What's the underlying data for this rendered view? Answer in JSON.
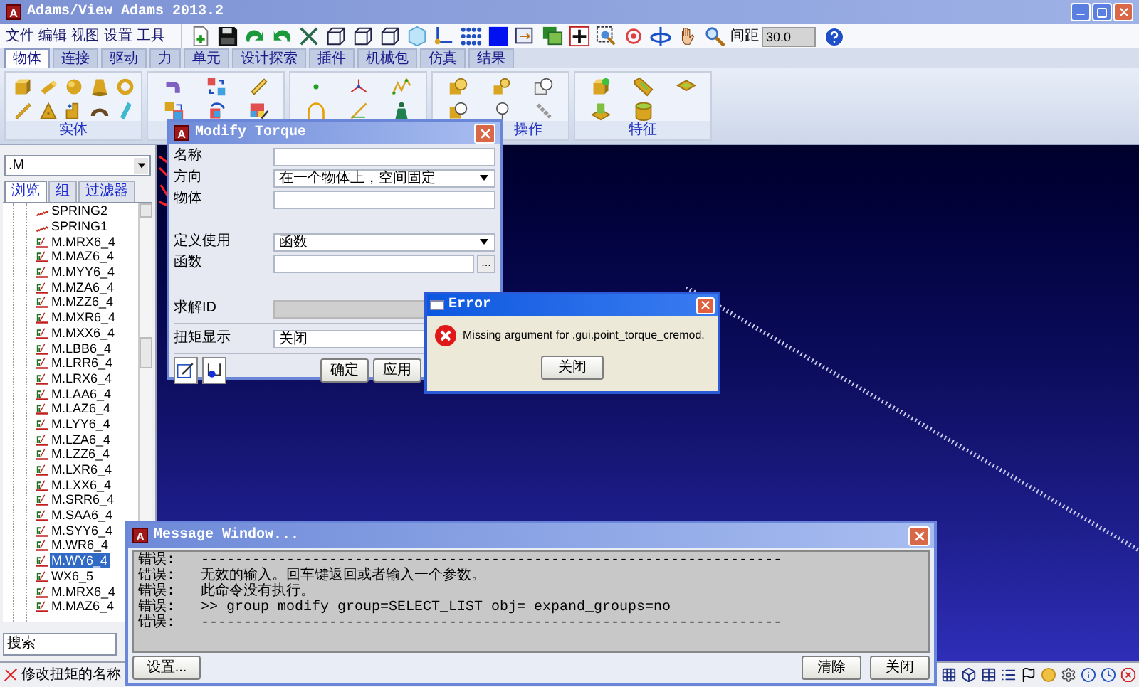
{
  "window": {
    "title": "Adams/View Adams 2013.2",
    "logo": "A"
  },
  "menu": [
    "文件",
    "编辑",
    "视图",
    "设置",
    "工具"
  ],
  "toolbar": {
    "spacing_label": "间距",
    "spacing_value": "30.0"
  },
  "ribbon_tabs": [
    {
      "label": "物体",
      "selected": true
    },
    {
      "label": "连接",
      "selected": false
    },
    {
      "label": "驱动",
      "selected": false
    },
    {
      "label": "力",
      "selected": false
    },
    {
      "label": "单元",
      "selected": false
    },
    {
      "label": "设计探索",
      "selected": false
    },
    {
      "label": "插件",
      "selected": false
    },
    {
      "label": "机械包",
      "selected": false
    },
    {
      "label": "仿真",
      "selected": false
    },
    {
      "label": "结果",
      "selected": false
    }
  ],
  "ribbon_groups": {
    "solids": "实体",
    "operations": "操作",
    "features": "特征"
  },
  "browser": {
    "filter": ".M",
    "tabs": [
      {
        "label": "浏览",
        "selected": true
      },
      {
        "label": "组",
        "selected": false
      },
      {
        "label": "过滤器",
        "selected": false
      }
    ],
    "tree": [
      {
        "label": "SPRING2",
        "kind": "spring",
        "selected": false
      },
      {
        "label": "SPRING1",
        "kind": "spring",
        "selected": false
      },
      {
        "label": "M.MRX6_4",
        "kind": "torque",
        "selected": false
      },
      {
        "label": "M.MAZ6_4",
        "kind": "torque",
        "selected": false
      },
      {
        "label": "M.MYY6_4",
        "kind": "torque",
        "selected": false
      },
      {
        "label": "M.MZA6_4",
        "kind": "torque",
        "selected": false
      },
      {
        "label": "M.MZZ6_4",
        "kind": "torque",
        "selected": false
      },
      {
        "label": "M.MXR6_4",
        "kind": "torque",
        "selected": false
      },
      {
        "label": "M.MXX6_4",
        "kind": "torque",
        "selected": false
      },
      {
        "label": "M.LBB6_4",
        "kind": "torque",
        "selected": false
      },
      {
        "label": "M.LRR6_4",
        "kind": "torque",
        "selected": false
      },
      {
        "label": "M.LRX6_4",
        "kind": "torque",
        "selected": false
      },
      {
        "label": "M.LAA6_4",
        "kind": "torque",
        "selected": false
      },
      {
        "label": "M.LAZ6_4",
        "kind": "torque",
        "selected": false
      },
      {
        "label": "M.LYY6_4",
        "kind": "torque",
        "selected": false
      },
      {
        "label": "M.LZA6_4",
        "kind": "torque",
        "selected": false
      },
      {
        "label": "M.LZZ6_4",
        "kind": "torque",
        "selected": false
      },
      {
        "label": "M.LXR6_4",
        "kind": "torque",
        "selected": false
      },
      {
        "label": "M.LXX6_4",
        "kind": "torque",
        "selected": false
      },
      {
        "label": "M.SRR6_4",
        "kind": "torque",
        "selected": false
      },
      {
        "label": "M.SAA6_4",
        "kind": "torque",
        "selected": false
      },
      {
        "label": "M.SYY6_4",
        "kind": "torque",
        "selected": false
      },
      {
        "label": "M.WR6_4",
        "kind": "torque",
        "selected": false
      },
      {
        "label": "M.WY6_4",
        "kind": "torque",
        "selected": true
      },
      {
        "label": "WX6_5",
        "kind": "torque",
        "selected": false
      },
      {
        "label": "M.MRX6_4",
        "kind": "torque",
        "selected": false
      },
      {
        "label": "M.MAZ6_4",
        "kind": "torque",
        "selected": false
      }
    ],
    "search_placeholder": "搜索"
  },
  "status_bar": {
    "text": "修改扭矩的名称"
  },
  "modify_torque": {
    "title": "Modify Torque",
    "logo": "A",
    "sections": [
      [
        {
          "label": "名称",
          "kind": "text",
          "disabled": false
        },
        {
          "label": "方向",
          "kind": "select",
          "value": "在一个物体上，空间固定",
          "disabled": false
        },
        {
          "label": "物体",
          "kind": "text",
          "disabled": false
        }
      ],
      [
        {
          "label": "定义使用",
          "kind": "select",
          "value": "函数",
          "disabled": false
        },
        {
          "label": "函数",
          "kind": "browse",
          "browse": "...",
          "disabled": false
        }
      ],
      [
        {
          "label": "求解ID",
          "kind": "text",
          "disabled": true
        }
      ],
      [
        {
          "label": "扭矩显示",
          "kind": "select",
          "value": "关闭",
          "disabled": false
        }
      ]
    ],
    "buttons": [
      "确定",
      "应用"
    ]
  },
  "error": {
    "title": "Error",
    "message": "Missing argument for .gui.point_torque_cremod.",
    "button": "关闭"
  },
  "message_window": {
    "title": "Message Window...",
    "logo": "A",
    "lines": [
      {
        "prefix": "错误:",
        "text": "--------------------------------------------------------------------"
      },
      {
        "prefix": "错误:",
        "text": "无效的输入。回车键返回或者输入一个参数。"
      },
      {
        "prefix": "错误:",
        "text": "此命令没有执行。"
      },
      {
        "prefix": "错误:",
        "text": ">> group modify group=SELECT_LIST obj= expand_groups=no"
      },
      {
        "prefix": "错误:",
        "text": "--------------------------------------------------------------------"
      }
    ],
    "buttons": {
      "settings": "设置...",
      "clear": "清除",
      "close": "关闭"
    }
  }
}
